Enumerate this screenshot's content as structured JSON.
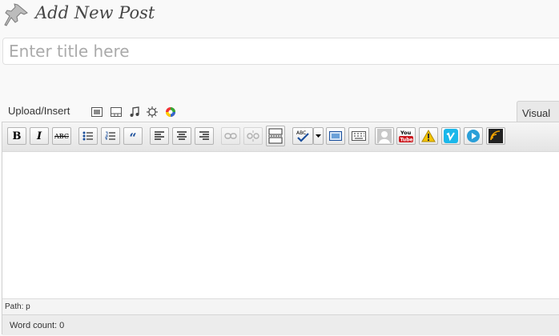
{
  "header": {
    "title": "Add New Post"
  },
  "title_input": {
    "placeholder": "Enter title here",
    "value": ""
  },
  "media": {
    "label": "Upload/Insert",
    "buttons": [
      "add-image",
      "add-video",
      "add-audio",
      "add-media",
      "add-gallery"
    ]
  },
  "tabs": {
    "visual": "Visual"
  },
  "toolbar": {
    "bold": "B",
    "italic": "I",
    "strikethrough": "ABC",
    "blockquote": "“",
    "youtube": "You\nTube"
  },
  "footer": {
    "path_label": "Path:",
    "path_value": "p",
    "wordcount_label": "Word count:",
    "wordcount_value": "0"
  },
  "colors": {
    "page_bg": "#f9f9f9",
    "toolbar_bg": "#e4e4e4",
    "youtube_red": "#cc181e",
    "vimeo_blue": "#1ab7ea"
  }
}
